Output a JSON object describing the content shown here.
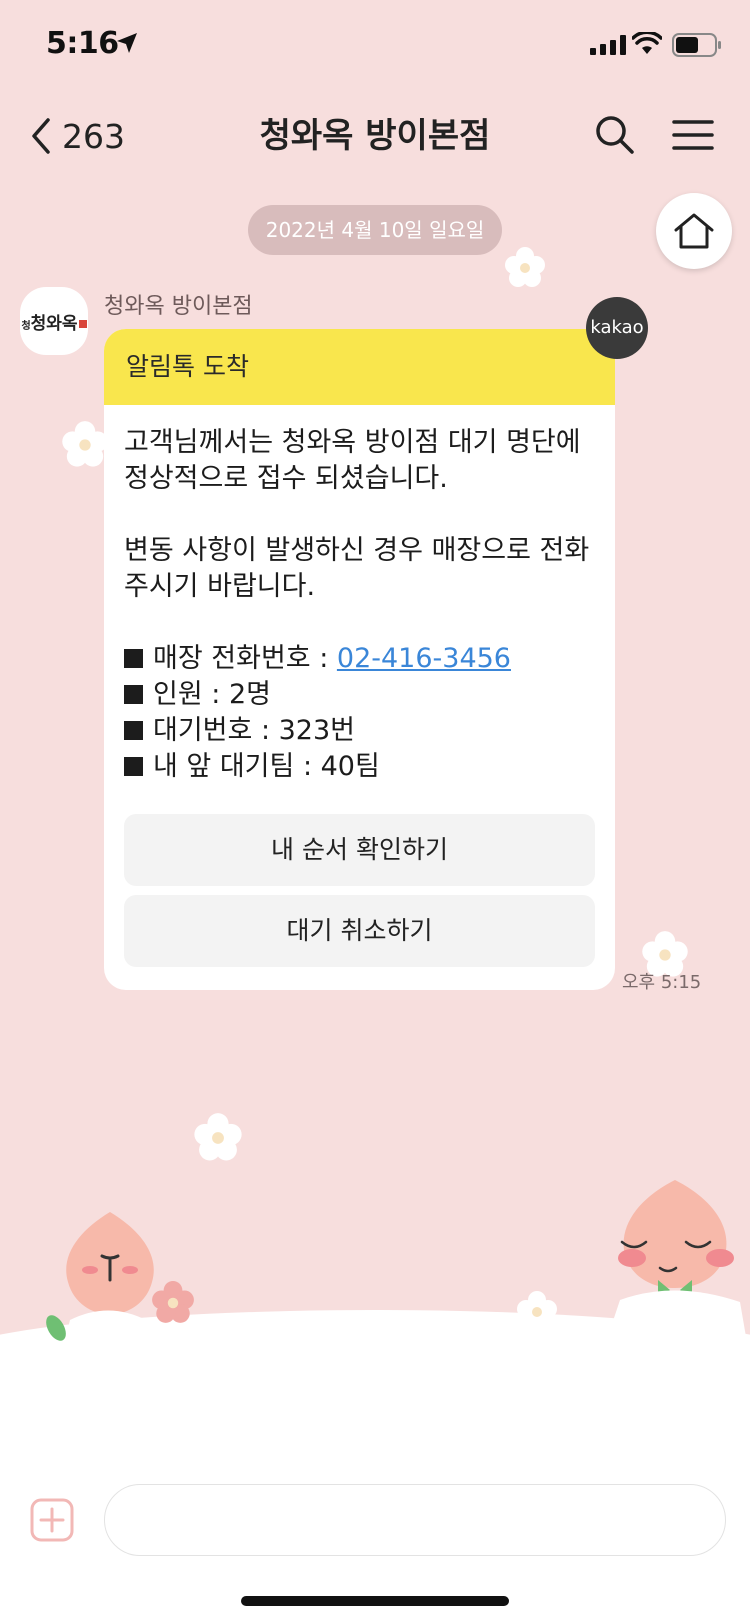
{
  "status_bar": {
    "time": "5:16",
    "icons": [
      "location-arrow-icon",
      "cellular-signal-icon",
      "wifi-icon",
      "battery-icon"
    ]
  },
  "header": {
    "back_count": "263",
    "title": "청와옥 방이본점",
    "icons": [
      "chevron-left-icon",
      "search-icon",
      "hamburger-menu-icon"
    ]
  },
  "date_divider": "2022년 4월 10일 일요일",
  "home_icon": "home-icon",
  "message": {
    "sender": "청와옥 방이본점",
    "avatar_logo": "청와옥",
    "avatar_logo_prefix": "청",
    "badge": "kakao",
    "header": "알림톡 도착",
    "body": {
      "line1": "고객님께서는 청와옥 방이점 대기 명단에",
      "line2": "정상적으로 접수 되셨습니다.",
      "line3": "변동 사항이 발생하신 경우 매장으로 전화",
      "line4": "주시기 바랍니다."
    },
    "info": {
      "phone_label": "매장 전화번호 : ",
      "phone": "02-416-3456",
      "people": "인원 : 2명",
      "waiting_number": "대기번호 : 323번",
      "teams_ahead": "내 앞 대기팀 : 40팀"
    },
    "buttons": {
      "check_order": "내 순서 확인하기",
      "cancel_wait": "대기 취소하기"
    },
    "time": "오후 5:15"
  },
  "input": {
    "placeholder": "",
    "add_icon": "plus-square-icon"
  },
  "colors": {
    "background": "#f7dedd",
    "card_header": "#f9e64d",
    "link": "#3a86d8",
    "date_pill": "#d8bcbc"
  }
}
